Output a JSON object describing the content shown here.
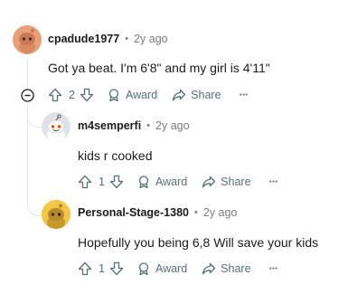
{
  "comments": [
    {
      "username": "cpadude1977",
      "separator": "•",
      "time": "2y ago",
      "text": "Got ya beat. I'm 6'8\" and my girl is 4'11\"",
      "votes": "2",
      "award_label": "Award",
      "share_label": "Share",
      "more_label": "···",
      "avatar_color": "#e8a07a"
    },
    {
      "username": "m4semperfi",
      "separator": "•",
      "time": "2y ago",
      "text": "kids r cooked",
      "votes": "1",
      "award_label": "Award",
      "share_label": "Share",
      "more_label": "···",
      "avatar_color": "#e9ecef"
    },
    {
      "username": "Personal-Stage-1380",
      "separator": "•",
      "time": "2y ago",
      "text": "Hopefully you being 6,8 Will save your kids",
      "votes": "1",
      "award_label": "Award",
      "share_label": "Share",
      "more_label": "···",
      "avatar_color": "#f2c744"
    }
  ],
  "collapse_icon": "minus-circle-icon"
}
